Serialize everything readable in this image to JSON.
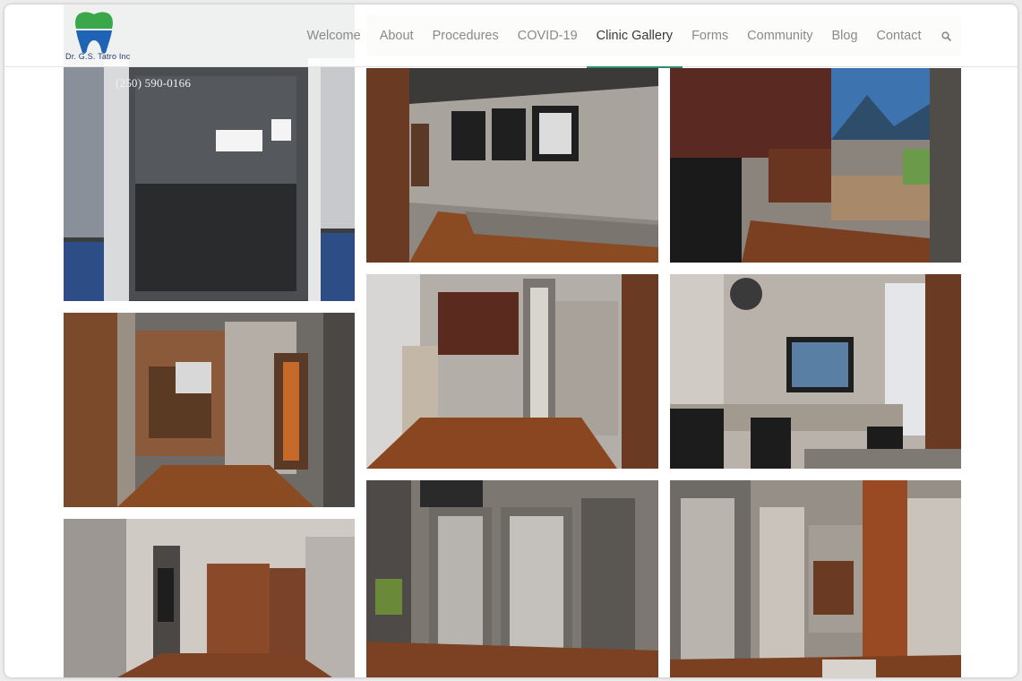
{
  "brand": {
    "name": "Dr. G.S. Tatro Inc",
    "colors": {
      "tooth_top": "#3aa84a",
      "tooth_bottom": "#1e63b4",
      "accent": "#2f8f6a"
    }
  },
  "nav": {
    "items": [
      {
        "label": "Welcome"
      },
      {
        "label": "About"
      },
      {
        "label": "Procedures"
      },
      {
        "label": "COVID-19"
      },
      {
        "label": "Clinic Gallery",
        "active": true
      },
      {
        "label": "Forms"
      },
      {
        "label": "Community"
      },
      {
        "label": "Blog"
      },
      {
        "label": "Contact"
      }
    ],
    "search_icon": "search-icon"
  },
  "gallery": {
    "door_phone": "(250) 590-0166"
  }
}
